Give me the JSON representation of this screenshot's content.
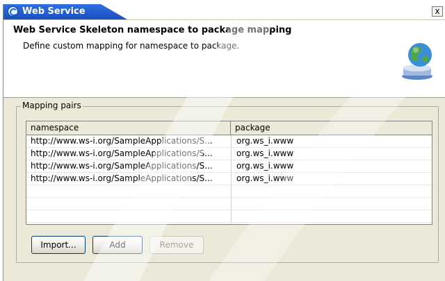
{
  "window": {
    "title": "Web Service",
    "close_label": "x"
  },
  "header": {
    "title": "Web Service Skeleton namespace to package mapping",
    "description": "Define custom mapping for namespace to package."
  },
  "group": {
    "legend": "Mapping pairs"
  },
  "table": {
    "columns": [
      "namespace",
      "package"
    ],
    "rows": [
      {
        "namespace": "http://www.ws-i.org/SampleApplications/S...",
        "package": "org.ws_i.www"
      },
      {
        "namespace": "http://www.ws-i.org/SampleApplications/S...",
        "package": "org.ws_i.www"
      },
      {
        "namespace": "http://www.ws-i.org/SampleApplications/S...",
        "package": "org.ws_i.www"
      },
      {
        "namespace": "http://www.ws-i.org/SampleApplications/S...",
        "package": "org.ws_i.www"
      },
      {
        "namespace": "",
        "package": ""
      },
      {
        "namespace": "",
        "package": ""
      },
      {
        "namespace": "",
        "package": ""
      }
    ]
  },
  "buttons": {
    "import": "Import...",
    "add": "Add",
    "remove": "Remove"
  },
  "colors": {
    "title_bar": "#1a4fbf",
    "dialog_bg": "#ece9d8",
    "disabled_text": "#a8a699"
  },
  "icons": {
    "app": "web-service-app-icon",
    "header": "globe-service-icon"
  }
}
